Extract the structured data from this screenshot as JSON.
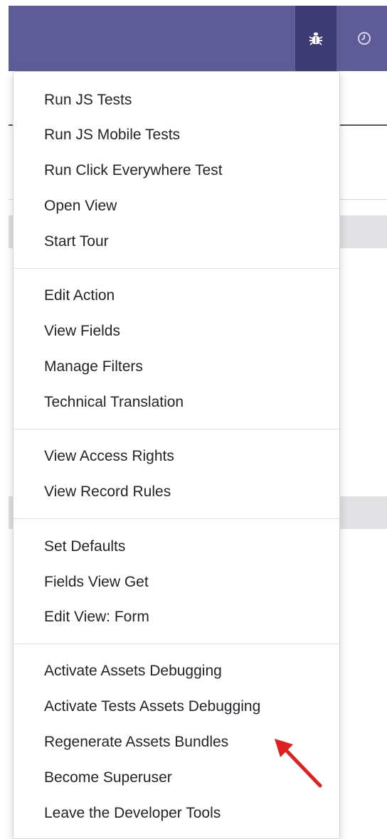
{
  "colors": {
    "navbar": "#5f5b97",
    "navbar_active": "#3e3b75",
    "menu_text": "#212529",
    "arrow": "#e02020"
  },
  "navbar": {
    "debug_icon": "bug-icon",
    "history_icon": "clock-icon"
  },
  "menu": {
    "groups": [
      [
        "Run JS Tests",
        "Run JS Mobile Tests",
        "Run Click Everywhere Test",
        "Open View",
        "Start Tour"
      ],
      [
        "Edit Action",
        "View Fields",
        "Manage Filters",
        "Technical Translation"
      ],
      [
        "View Access Rights",
        "View Record Rules"
      ],
      [
        "Set Defaults",
        "Fields View Get",
        "Edit View: Form"
      ],
      [
        "Activate Assets Debugging",
        "Activate Tests Assets Debugging",
        "Regenerate Assets Bundles",
        "Become Superuser",
        "Leave the Developer Tools"
      ]
    ]
  }
}
